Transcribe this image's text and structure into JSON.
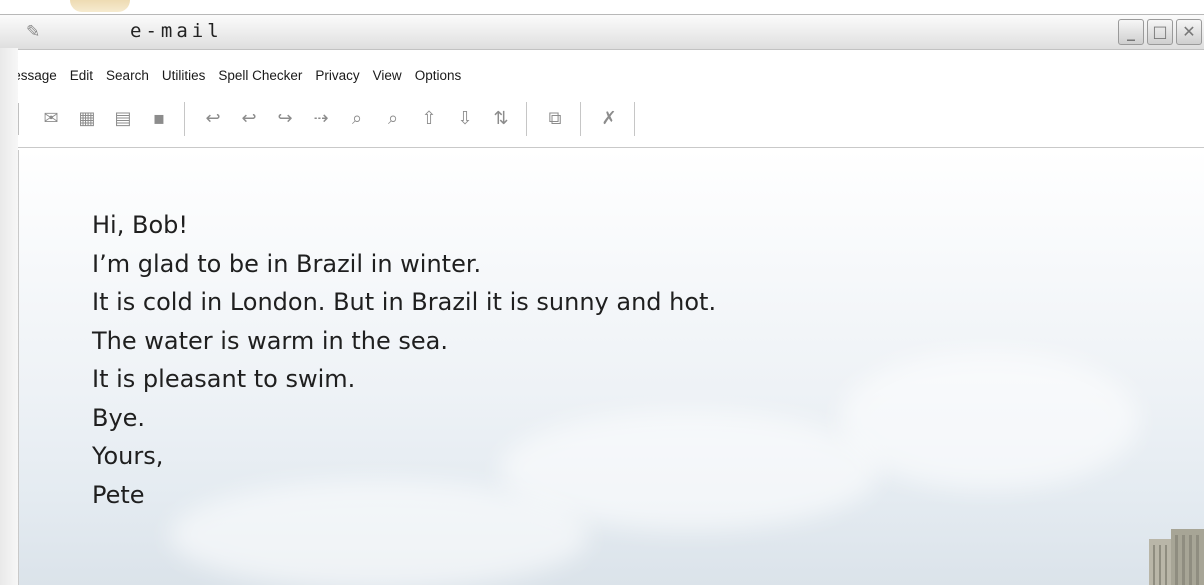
{
  "window": {
    "title": "e-mail",
    "app_icon": "pin-icon",
    "controls": [
      "minimize-icon",
      "maximize-icon",
      "close-icon"
    ]
  },
  "menubar": {
    "items": [
      {
        "label": "Message"
      },
      {
        "label": "Edit"
      },
      {
        "label": "Search"
      },
      {
        "label": "Utilities"
      },
      {
        "label": "Spell Checker"
      },
      {
        "label": "Privacy"
      },
      {
        "label": "View"
      },
      {
        "label": "Options"
      }
    ]
  },
  "toolbar": {
    "groups": [
      [
        "new-message-icon",
        "open-mailbox-icon",
        "delete-icon",
        "save-icon"
      ],
      [
        "reply-icon",
        "reply-all-icon",
        "forward-icon",
        "redirect-icon",
        "find-icon",
        "find-next-icon",
        "send-icon",
        "receive-icon",
        "send-receive-icon"
      ],
      [
        "attach-icon"
      ],
      [
        "cancel-icon"
      ]
    ]
  },
  "message": {
    "lines": [
      "Hi, Bob!",
      "I’m glad to be in Brazil in winter.",
      "It is cold in London. But in Brazil it is sunny and hot.",
      "The water is warm in the sea.",
      "It is pleasant to swim.",
      "Bye.",
      "Yours,",
      "Pete"
    ]
  },
  "colors": {
    "title_bar": "#ececec",
    "text": "#1f1f1f",
    "background_sky": "#e4ebf1"
  }
}
